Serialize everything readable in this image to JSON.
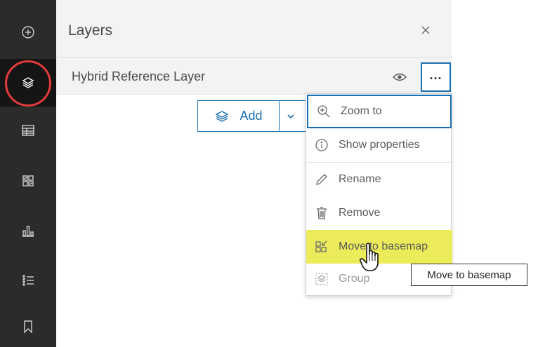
{
  "panel": {
    "title": "Layers",
    "layer_name": "Hybrid Reference Layer",
    "add_label": "Add"
  },
  "menu": {
    "items": [
      {
        "label": "Zoom to",
        "icon": "zoom-in-icon",
        "state": "focused"
      },
      {
        "label": "Show properties",
        "icon": "information-icon",
        "state": "normal"
      },
      {
        "label": "Rename",
        "icon": "pencil-icon",
        "state": "normal"
      },
      {
        "label": "Remove",
        "icon": "trash-icon",
        "state": "normal"
      },
      {
        "label": "Move to basemap",
        "icon": "move-to-basemap-icon",
        "state": "hover"
      },
      {
        "label": "Group",
        "icon": "group-layers-icon",
        "state": "disabled"
      }
    ]
  },
  "tooltip": {
    "text": "Move to basemap"
  },
  "actionbar": {
    "items": [
      {
        "icon": "add-icon"
      },
      {
        "icon": "layers-icon",
        "active": true
      },
      {
        "icon": "table-icon"
      },
      {
        "icon": "legend-icon"
      },
      {
        "icon": "chart-icon"
      },
      {
        "icon": "list-icon"
      },
      {
        "icon": "bookmark-icon"
      }
    ]
  },
  "colors": {
    "accent": "#1a6fb3",
    "highlight": "#ecec5a",
    "ring": "#e23b3b",
    "actionbar": "#2b2b2b"
  }
}
